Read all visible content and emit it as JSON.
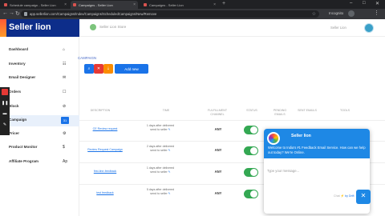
{
  "browser": {
    "tabs": [
      {
        "title": "Schedule campaign - Seller Lion"
      },
      {
        "title": "Campaigns - Seller Lion"
      },
      {
        "title": "Campaigns - Seller Lion"
      }
    ],
    "url": "app.sellerlion.com/Campaigns/Index/Campaigns/ScheduledCampaigns/New/Remove",
    "profile": "Incognito",
    "close_label": "×",
    "new_tab_label": "+"
  },
  "header": {
    "store_name": "Seller Lion Store",
    "user_name": "Seller Lion"
  },
  "sidebar": {
    "brand": "Seller lion",
    "items": [
      {
        "label": "Dashboard",
        "icon": "⌂"
      },
      {
        "label": "Inventory",
        "icon": "☷"
      },
      {
        "label": "Email Designer",
        "icon": "✉"
      },
      {
        "label": "Orders",
        "icon": "☐"
      },
      {
        "label": "Block",
        "icon": "⊘"
      },
      {
        "label": "Campaign",
        "icon": "31"
      },
      {
        "label": "Pricer",
        "icon": "⚙"
      },
      {
        "label": "Product Monitor",
        "icon": "$"
      },
      {
        "label": "Affiliate Program",
        "icon": "Ap"
      }
    ]
  },
  "page": {
    "breadcrumb": "CAMPAIGN",
    "square_buttons": [
      "⌕",
      "✕",
      "⇣"
    ],
    "add_new": "Add new",
    "columns": [
      "DESCRIPTION",
      "TIME",
      "FULFILLMENT CHANNEL",
      "STATUS",
      "PENDING EMAILS",
      "SENT EMAILS",
      "TOOLS"
    ]
  },
  "rows": [
    {
      "name": "CE Review request",
      "time1": "1 days after delivered",
      "time2": "send to seller",
      "ful": "ANY",
      "pending": "",
      "sent": ""
    },
    {
      "name": "Review Request Campaign",
      "time1": "2 days after delivered",
      "time2": "send to seller",
      "ful": "ANY",
      "pending": "",
      "sent": ""
    },
    {
      "name": "first-line-feedback",
      "time1": "1 days after delivered",
      "time2": "send to seller",
      "ful": "ANY",
      "pending": "",
      "sent": ""
    },
    {
      "name": "test feedback",
      "time1": "5 days after delivered",
      "time2": "send to seller",
      "ful": "ANY",
      "pending": "0",
      "sent": "3094"
    }
  ],
  "chat": {
    "title": "Seller lion",
    "message": "Welcome to India's #1 Feedback Email Service. How can we help out today? We're Online.",
    "input_placeholder": "Type your message...",
    "footer_prefix": "Chat",
    "footer_by": "by Drift",
    "fab_icon": "✕"
  },
  "colors": {
    "accent": "#1a73e8",
    "brand_navy": "#0d2d8a",
    "toggle_on": "#34a853",
    "chat_blue": "#1e88e5"
  }
}
